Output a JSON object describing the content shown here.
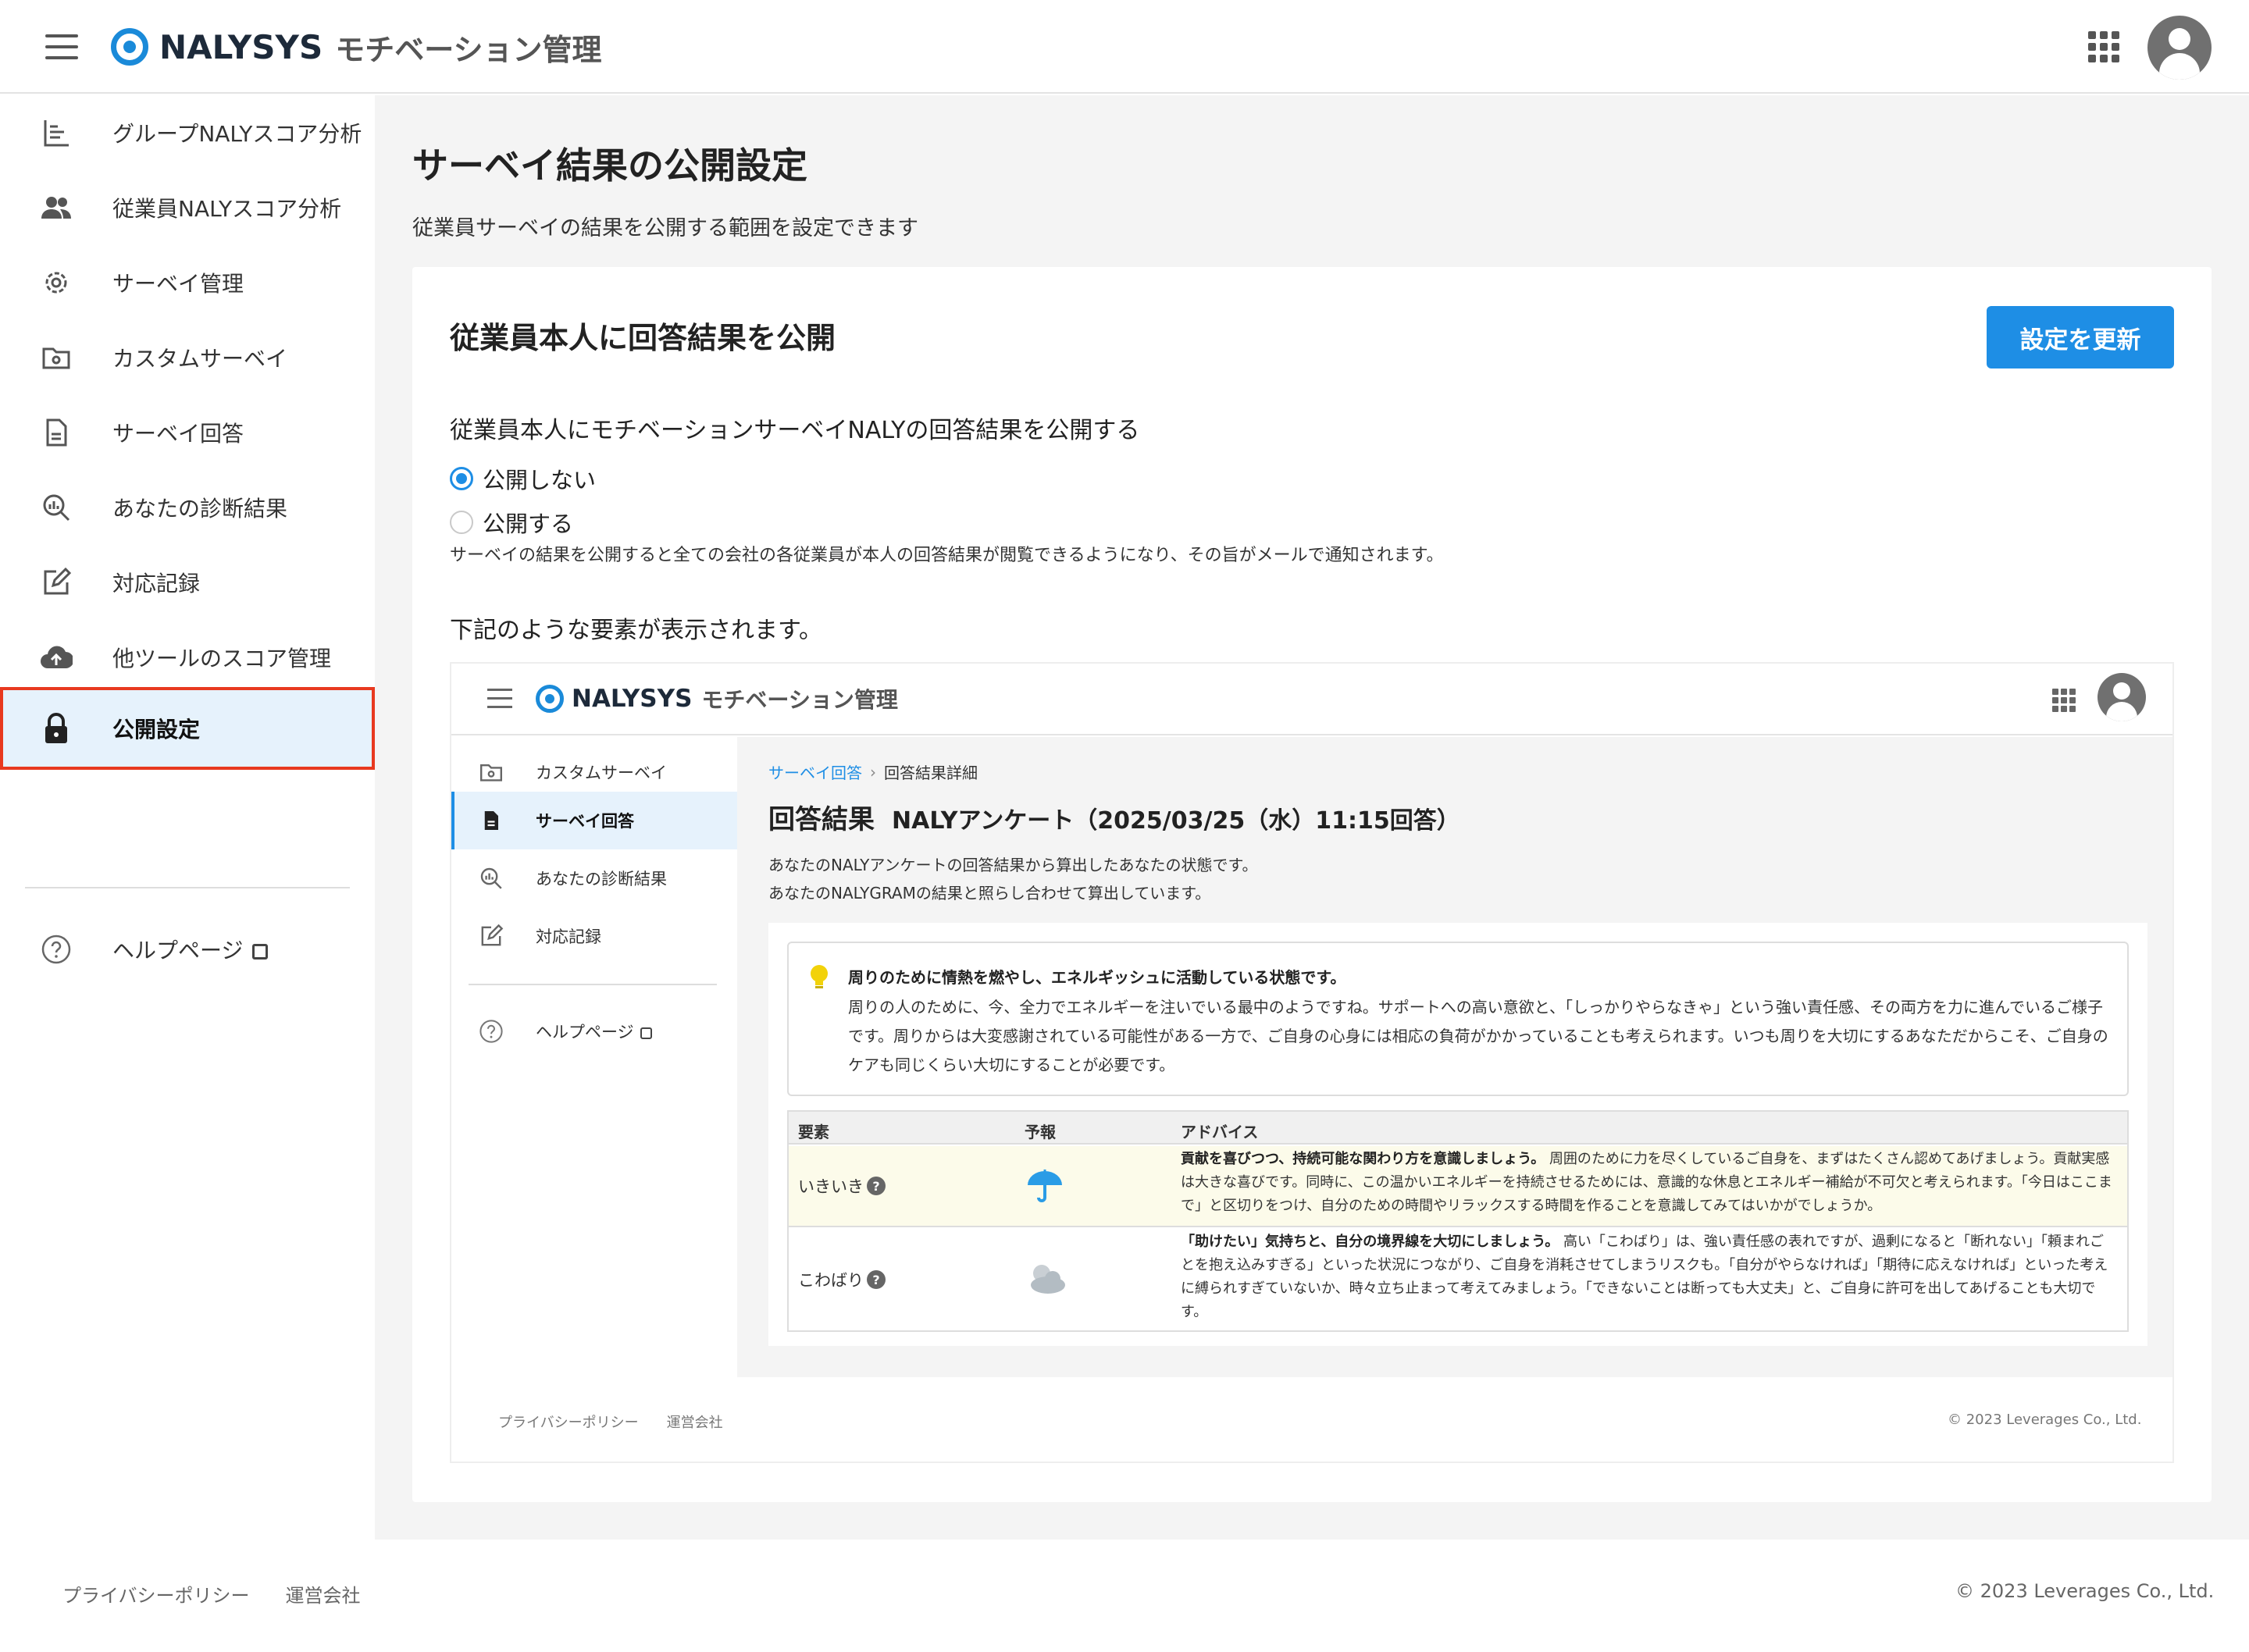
{
  "app": {
    "brand": "NALYSYS",
    "product": "モチベーション管理"
  },
  "sidebar": {
    "items": [
      {
        "label": "グループNALYスコア分析",
        "icon": "bar-chart-icon"
      },
      {
        "label": "従業員NALYスコア分析",
        "icon": "people-icon"
      },
      {
        "label": "サーベイ管理",
        "icon": "gear-icon"
      },
      {
        "label": "カスタムサーベイ",
        "icon": "folder-gear-icon"
      },
      {
        "label": "サーベイ回答",
        "icon": "document-icon"
      },
      {
        "label": "あなたの診断結果",
        "icon": "magnifier-chart-icon"
      },
      {
        "label": "対応記録",
        "icon": "edit-icon"
      },
      {
        "label": "他ツールのスコア管理",
        "icon": "cloud-upload-icon"
      },
      {
        "label": "公開設定",
        "icon": "lock-icon",
        "active": true
      }
    ],
    "help": "ヘルプページ"
  },
  "page": {
    "title": "サーベイ結果の公開設定",
    "description": "従業員サーベイの結果を公開する範囲を設定できます"
  },
  "card": {
    "title": "従業員本人に回答結果を公開",
    "update_button": "設定を更新",
    "question": "従業員本人にモチベーションサーベイNALYの回答結果を公開する",
    "options": [
      "公開しない",
      "公開する"
    ],
    "selected": "公開しない",
    "note": "サーベイの結果を公開すると全ての会社の各従業員が本人の回答結果が閲覧できるようになり、その旨がメールで通知されます。",
    "preview_heading": "下記のような要素が表示されます。"
  },
  "preview": {
    "sidebar": [
      "カスタムサーベイ",
      "サーベイ回答",
      "あなたの診断結果",
      "対応記録"
    ],
    "active": "サーベイ回答",
    "help": "ヘルプページ",
    "breadcrumb": {
      "link": "サーベイ回答",
      "current": "回答結果詳細"
    },
    "title": "回答結果",
    "title_sub": "NALYアンケート（2025/03/25（水）11:15回答）",
    "desc_lines": [
      "あなたのNALYアンケートの回答結果から算出したあなたの状態です。",
      "あなたのNALYGRAMの結果と照らし合わせて算出しています。"
    ],
    "state_title": "周りのために情熱を燃やし、エネルギッシュに活動している状態です。",
    "state_body": "周りの人のために、今、全力でエネルギーを注いでいる最中のようですね。サポートへの高い意欲と、「しっかりやらなきゃ」という強い責任感、その両方を力に進んでいるご様子です。周りからは大変感謝されている可能性がある一方で、ご自身の心身には相応の負荷がかかっていることも考えられます。いつも周りを大切にするあなただからこそ、ご自身のケアも同じくらい大切にすることが必要です。",
    "table": {
      "headers": [
        "要素",
        "予報",
        "アドバイス"
      ],
      "rows": [
        {
          "element": "いきいき",
          "forecast_icon": "umbrella-icon",
          "advice_bold": "貢献を喜びつつ、持続可能な関わり方を意識しましょう。",
          "advice": "周囲のために力を尽くしているご自身を、まずはたくさん認めてあげましょう。貢献実感は大きな喜びです。同時に、この温かいエネルギーを持続させるためには、意識的な休息とエネルギー補給が不可欠と考えられます。「今日はここまで」と区切りをつけ、自分のための時間やリラックスする時間を作ることを意識してみてはいかがでしょうか。"
        },
        {
          "element": "こわばり",
          "forecast_icon": "cloudy-icon",
          "advice_bold": "「助けたい」気持ちと、自分の境界線を大切にしましょう。",
          "advice": "高い「こわばり」は、強い責任感の表れですが、過剰になると「断れない」「頼まれごとを抱え込みすぎる」といった状況につながり、ご自身を消耗させてしまうリスクも。「自分がやらなければ」「期待に応えなければ」といった考えに縛られすぎていないか、時々立ち止まって考えてみましょう。「できないことは断っても大丈夫」と、ご自身に許可を出してあげることも大切です。"
        }
      ]
    },
    "footer_links": [
      "プライバシーポリシー",
      "運営会社"
    ],
    "copyright": "© 2023 Leverages Co., Ltd."
  },
  "footer": {
    "links": [
      "プライバシーポリシー",
      "運営会社"
    ],
    "copyright": "© 2023 Leverages Co., Ltd."
  },
  "colors": {
    "accent": "#1e8ee5",
    "highlight_border": "#e8391f",
    "active_bg": "#e6f2fc"
  }
}
